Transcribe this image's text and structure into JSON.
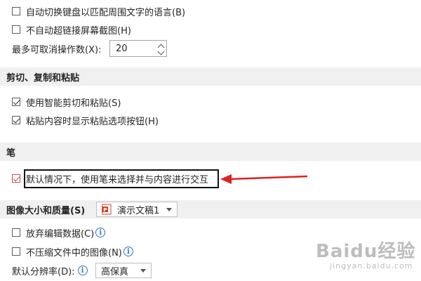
{
  "options": {
    "auto_keyboard_label": "自动切换键盘以匹配周围文字的语言(B)",
    "no_auto_hyperlink_label": "不自动超链接屏幕截图(H)",
    "max_undo_label": "最多可取消操作数(X):",
    "max_undo_value": "20"
  },
  "sections": {
    "cut_copy_paste": "剪切、复制和粘贴",
    "pen": "笔",
    "image_size_quality": "图像大小和质量(S)"
  },
  "cut_copy_paste": {
    "smart_cut_label": "使用智能剪切和粘贴(S)",
    "paste_options_label": "粘贴内容时显示粘贴选项按钮(H)"
  },
  "pen": {
    "default_pen_label": "默认情况下，使用笔来选择并与内容进行交互"
  },
  "image": {
    "document_name": "演示文稿1",
    "discard_edit_label": "放弃编辑数据(C)",
    "no_compress_label": "不压缩文件中的图像(N)",
    "default_resolution_label": "默认分辨率(D):",
    "default_resolution_value": "高保真"
  },
  "watermark": {
    "brand": "Baidu经验",
    "url": "jingyan.baidu.com"
  },
  "colors": {
    "section_bg": "#f0f0f0",
    "arrow": "#e02020",
    "info_blue": "#2b78c2",
    "ppt_red": "#d24726"
  },
  "icons": {
    "info": "info-circle-icon",
    "ppt": "powerpoint-file-icon"
  }
}
